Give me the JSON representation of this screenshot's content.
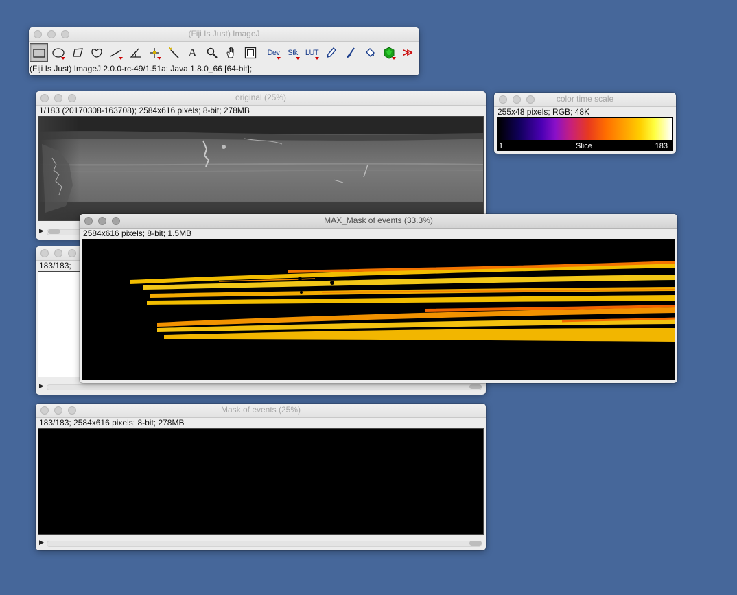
{
  "imagej": {
    "title": "(Fiji Is Just) ImageJ",
    "status": "(Fiji Is Just) ImageJ 2.0.0-rc-49/1.51a; Java 1.8.0_66 [64-bit];",
    "tools": {
      "dev": "Dev",
      "stk": "Stk",
      "lut": "LUT",
      "text_tool": "A",
      "more": "≫"
    }
  },
  "original": {
    "title": "original (25%)",
    "info": "1/183 (20170308-163708); 2584x616 pixels; 8-bit; 278MB"
  },
  "colortime": {
    "title": "color time scale",
    "info": "255x48 pixels; RGB; 48K",
    "scale_min": "1",
    "scale_label": "Slice",
    "scale_max": "183"
  },
  "hidden_window": {
    "info": "183/183;"
  },
  "max_mask": {
    "title": "MAX_Mask of events (33.3%)",
    "info": "2584x616 pixels; 8-bit; 1.5MB"
  },
  "mask": {
    "title": "Mask of events (25%)",
    "info": "183/183; 2584x616 pixels; 8-bit; 278MB"
  }
}
